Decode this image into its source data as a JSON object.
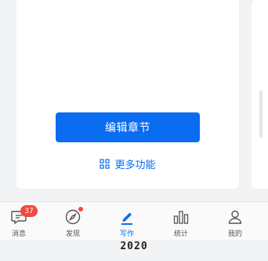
{
  "card": {
    "primary_button": "编辑章节",
    "more_link": "更多功能"
  },
  "tabs": [
    {
      "label": "消息",
      "icon": "message-icon",
      "badge": "37"
    },
    {
      "label": "发现",
      "icon": "compass-icon",
      "dot": true
    },
    {
      "label": "写作",
      "icon": "pen-icon",
      "active": true
    },
    {
      "label": "统计",
      "icon": "stats-icon"
    },
    {
      "label": "我的",
      "icon": "person-icon"
    }
  ],
  "footer": {
    "year": "2020"
  },
  "colors": {
    "accent": "#0a6cf0",
    "badge": "#f04a3e"
  }
}
